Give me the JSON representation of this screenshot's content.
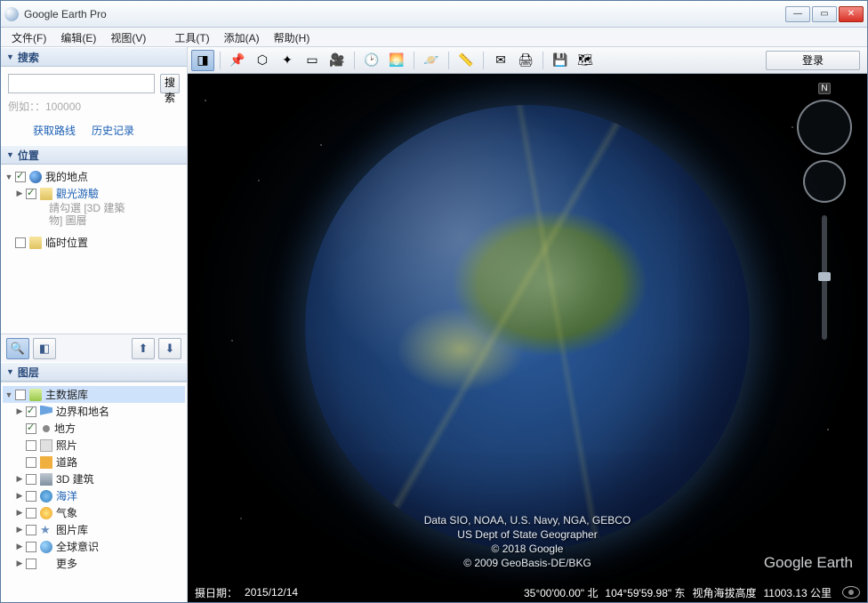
{
  "app": {
    "title": "Google Earth Pro"
  },
  "menu": {
    "file": "文件(F)",
    "edit": "编辑(E)",
    "view": "视图(V)",
    "tools": "工具(T)",
    "add": "添加(A)",
    "help": "帮助(H)"
  },
  "toolbar": {
    "login": "登录"
  },
  "search": {
    "header": "搜索",
    "button": "搜索",
    "placeholder": "例如：：100000",
    "get_directions": "获取路线",
    "history": "历史记录"
  },
  "places": {
    "header": "位置",
    "my_places": "我的地点",
    "sightseeing": "觀光游驗",
    "note1": "請勾選 [3D 建築",
    "note2": "物] 圖層",
    "temp": "临时位置"
  },
  "layers": {
    "header": "图层",
    "primary_db": "主数据库",
    "borders": "边界和地名",
    "places": "地方",
    "photos": "照片",
    "roads": "道路",
    "buildings3d": "3D 建筑",
    "ocean": "海洋",
    "weather": "气象",
    "gallery": "图片库",
    "awareness": "全球意识",
    "more": "更多"
  },
  "viewport": {
    "attr1": "Data SIO, NOAA, U.S. Navy, NGA, GEBCO",
    "attr2": "US Dept of State Geographer",
    "attr3": "© 2018 Google",
    "attr4": "© 2009 GeoBasis-DE/BKG",
    "watermark": "Google Earth",
    "compass_n": "N"
  },
  "status": {
    "date_label": "摄日期：",
    "date": "2015/12/14",
    "lat": "35°00'00.00\" 北",
    "lon": "104°59'59.98\" 东",
    "alt_label": "视角海拔高度",
    "alt_value": "11003.13 公里"
  }
}
